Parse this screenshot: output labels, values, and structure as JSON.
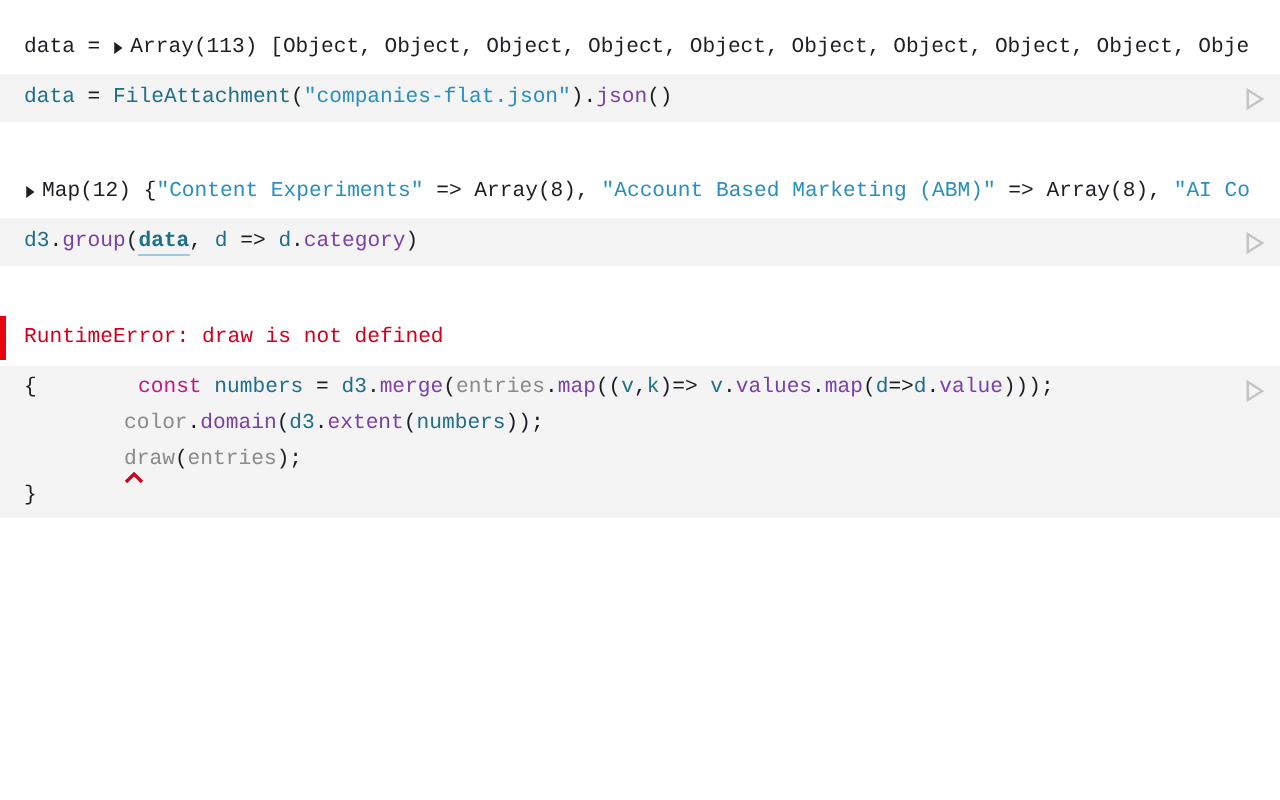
{
  "cells": [
    {
      "output": {
        "kind": "value",
        "label": "data =",
        "expanded": false,
        "tokens": [
          {
            "text": "Array(113) [Object, Object, Object, Object, Object, Object, Object, Object, Object, Obje",
            "kind": "plain"
          }
        ]
      },
      "code": {
        "lines": [
          {
            "error": false,
            "indented": false,
            "tokens": [
              {
                "text": "data",
                "kind": "var"
              },
              {
                "text": " = ",
                "kind": "plain"
              },
              {
                "text": "FileAttachment",
                "kind": "var"
              },
              {
                "text": "(",
                "kind": "plain"
              },
              {
                "text": "\"companies-flat.json\"",
                "kind": "str"
              },
              {
                "text": ").",
                "kind": "plain"
              },
              {
                "text": "json",
                "kind": "fn"
              },
              {
                "text": "()",
                "kind": "plain"
              }
            ]
          }
        ]
      }
    },
    {
      "output": {
        "kind": "value",
        "expanded": false,
        "tokens": [
          {
            "text": "Map(12) {",
            "kind": "plain"
          },
          {
            "text": "\"Content Experiments\"",
            "kind": "str"
          },
          {
            "text": " => Array(8), ",
            "kind": "plain"
          },
          {
            "text": "\"Account Based Marketing (ABM)\"",
            "kind": "str"
          },
          {
            "text": " => Array(8), ",
            "kind": "plain"
          },
          {
            "text": "\"AI Co",
            "kind": "str"
          }
        ]
      },
      "code": {
        "lines": [
          {
            "error": false,
            "indented": false,
            "tokens": [
              {
                "text": "d3",
                "kind": "var"
              },
              {
                "text": ".",
                "kind": "plain"
              },
              {
                "text": "group",
                "kind": "fn"
              },
              {
                "text": "(",
                "kind": "plain"
              },
              {
                "text": "data",
                "kind": "ref"
              },
              {
                "text": ", ",
                "kind": "plain"
              },
              {
                "text": "d",
                "kind": "var"
              },
              {
                "text": " => ",
                "kind": "plain"
              },
              {
                "text": "d",
                "kind": "var"
              },
              {
                "text": ".",
                "kind": "plain"
              },
              {
                "text": "category",
                "kind": "fn"
              },
              {
                "text": ")",
                "kind": "plain"
              }
            ]
          }
        ]
      }
    },
    {
      "output": {
        "kind": "error",
        "text": "RuntimeError: draw is not defined"
      },
      "code": {
        "lines": [
          {
            "error": false,
            "indented": false,
            "tokens": [
              {
                "text": "{",
                "kind": "brace"
              },
              {
                "text": "const ",
                "kind": "kw"
              },
              {
                "text": "numbers",
                "kind": "var"
              },
              {
                "text": " = ",
                "kind": "plain"
              },
              {
                "text": "d3",
                "kind": "var"
              },
              {
                "text": ".",
                "kind": "plain"
              },
              {
                "text": "merge",
                "kind": "fn"
              },
              {
                "text": "(",
                "kind": "plain"
              },
              {
                "text": "entries",
                "kind": "dim"
              },
              {
                "text": ".",
                "kind": "plain"
              },
              {
                "text": "map",
                "kind": "fn"
              },
              {
                "text": "((",
                "kind": "plain"
              },
              {
                "text": "v",
                "kind": "var"
              },
              {
                "text": ",",
                "kind": "plain"
              },
              {
                "text": "k",
                "kind": "var"
              },
              {
                "text": ")=> ",
                "kind": "plain"
              },
              {
                "text": "v",
                "kind": "var"
              },
              {
                "text": ".",
                "kind": "plain"
              },
              {
                "text": "values",
                "kind": "fn"
              },
              {
                "text": ".",
                "kind": "plain"
              },
              {
                "text": "map",
                "kind": "fn"
              },
              {
                "text": "(",
                "kind": "plain"
              },
              {
                "text": "d",
                "kind": "var"
              },
              {
                "text": "=>",
                "kind": "plain"
              },
              {
                "text": "d",
                "kind": "var"
              },
              {
                "text": ".",
                "kind": "plain"
              },
              {
                "text": "value",
                "kind": "fn"
              },
              {
                "text": ")));",
                "kind": "plain"
              }
            ]
          },
          {
            "error": false,
            "indented": true,
            "tokens": [
              {
                "text": "color",
                "kind": "dim"
              },
              {
                "text": ".",
                "kind": "plain"
              },
              {
                "text": "domain",
                "kind": "fn"
              },
              {
                "text": "(",
                "kind": "plain"
              },
              {
                "text": "d3",
                "kind": "var"
              },
              {
                "text": ".",
                "kind": "plain"
              },
              {
                "text": "extent",
                "kind": "fn"
              },
              {
                "text": "(",
                "kind": "plain"
              },
              {
                "text": "numbers",
                "kind": "var"
              },
              {
                "text": "));",
                "kind": "plain"
              }
            ]
          },
          {
            "error": true,
            "indented": true,
            "tokens": [
              {
                "text": "draw",
                "kind": "dim"
              },
              {
                "text": "(",
                "kind": "plain"
              },
              {
                "text": "entries",
                "kind": "dim"
              },
              {
                "text": ");",
                "kind": "plain"
              }
            ]
          },
          {
            "error": false,
            "indented": false,
            "tokens": [
              {
                "text": "}",
                "kind": "plain"
              }
            ]
          }
        ]
      }
    }
  ]
}
